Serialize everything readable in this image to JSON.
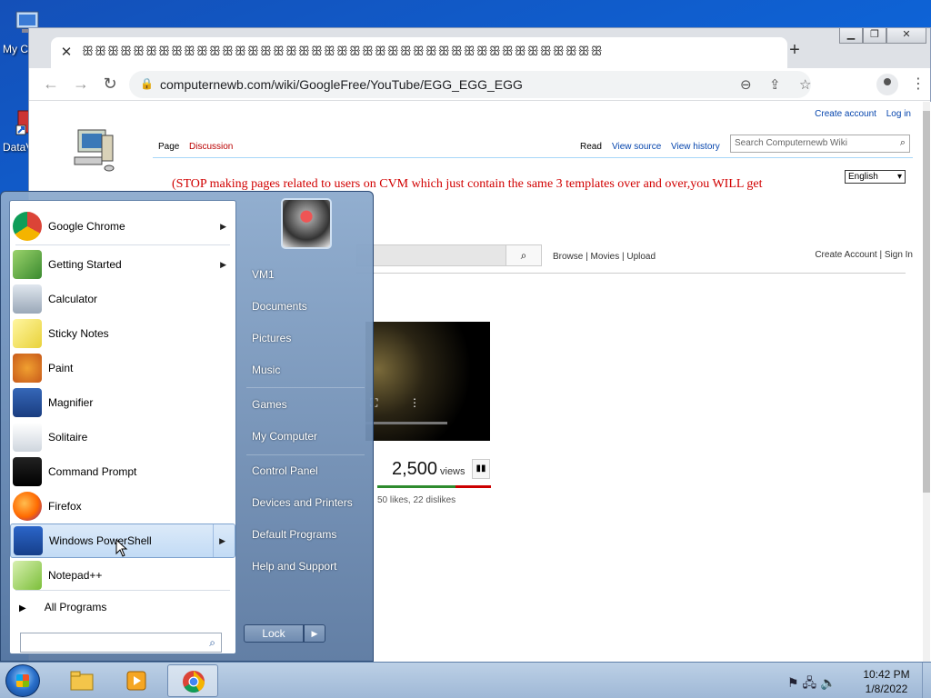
{
  "desktop": {
    "icons": [
      {
        "label": "My C",
        "icon": "computer-icon"
      },
      {
        "label": "DataV",
        "icon": "shortcut-icon"
      }
    ]
  },
  "browser": {
    "tab_title": "ꕥꕥꕥꕥꕥꕥꕥꕥꕥꕥꕥꕥꕥꕥꕥꕥꕥꕥꕥꕥꕥꕥꕥꕥꕥꕥꕥꕥꕥꕥꕥꕥꕥꕥꕥꕥꕥꕥꕥꕥꕥ",
    "url": "computernewb.com/wiki/GoogleFree/YouTube/EGG_EGG_EGG"
  },
  "wiki": {
    "create_account": "Create account",
    "log_in": "Log in",
    "tab_page": "Page",
    "tab_discussion": "Discussion",
    "tab_read": "Read",
    "tab_view_source": "View source",
    "tab_view_history": "View history",
    "search_placeholder": "Search Computernewb Wiki",
    "language": "English",
    "warning": "(STOP making pages related to users on CVM which just contain the same 3 templates over and over,you WILL get"
  },
  "youtube": {
    "browse": "Browse",
    "movies": "Movies",
    "upload": "Upload",
    "create_account": "Create Account",
    "sign_in": "Sign In",
    "views_count": "2,500",
    "views_label": "views",
    "likes_text": "50 likes, 22 dislikes",
    "like_ratio": 0.69
  },
  "start_menu": {
    "programs": [
      {
        "label": "Google Chrome",
        "icon": "chrome-icon",
        "submenu": true
      },
      {
        "label": "Getting Started",
        "icon": "getting-started-icon",
        "submenu": true
      },
      {
        "label": "Calculator",
        "icon": "calculator-icon",
        "submenu": false
      },
      {
        "label": "Sticky Notes",
        "icon": "sticky-notes-icon",
        "submenu": false
      },
      {
        "label": "Paint",
        "icon": "paint-icon",
        "submenu": false
      },
      {
        "label": "Magnifier",
        "icon": "magnifier-icon",
        "submenu": false
      },
      {
        "label": "Solitaire",
        "icon": "solitaire-icon",
        "submenu": false
      },
      {
        "label": "Command Prompt",
        "icon": "cmd-icon",
        "submenu": false
      },
      {
        "label": "Firefox",
        "icon": "firefox-icon",
        "submenu": false
      },
      {
        "label": "Windows PowerShell",
        "icon": "powershell-icon",
        "submenu": true
      },
      {
        "label": "Notepad++",
        "icon": "notepadpp-icon",
        "submenu": false
      }
    ],
    "all_programs": "All Programs",
    "right_items": [
      "VM1",
      "Documents",
      "Pictures",
      "Music",
      "Games",
      "My Computer",
      "Control Panel",
      "Devices and Printers",
      "Default Programs",
      "Help and Support"
    ],
    "lock_label": "Lock"
  },
  "taskbar": {
    "time": "10:42 PM",
    "date": "1/8/2022"
  },
  "colors": {
    "warning_red": "#d10000",
    "link_blue": "#0645ad",
    "like_green": "#2e8b2e",
    "dislike_red": "#cc0000"
  }
}
